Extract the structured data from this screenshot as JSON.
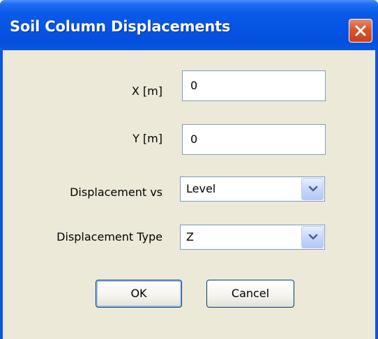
{
  "window": {
    "title": "Soil Column Displacements"
  },
  "icons": {
    "close": "close-icon",
    "dropdown": "chevron-down-icon"
  },
  "colors": {
    "titlebar": "#0a55e6",
    "close_button": "#d9552c",
    "dialog_background": "#ece9d8",
    "field_border": "#7f9db9"
  },
  "form": {
    "x": {
      "label": "X  [m]",
      "value": "0"
    },
    "y": {
      "label": "Y  [m]",
      "value": "0"
    },
    "displacement_vs": {
      "label": "Displacement vs",
      "value": "Level"
    },
    "displacement_type": {
      "label": "Displacement Type",
      "value": "Z"
    }
  },
  "buttons": {
    "ok": "OK",
    "cancel": "Cancel"
  }
}
